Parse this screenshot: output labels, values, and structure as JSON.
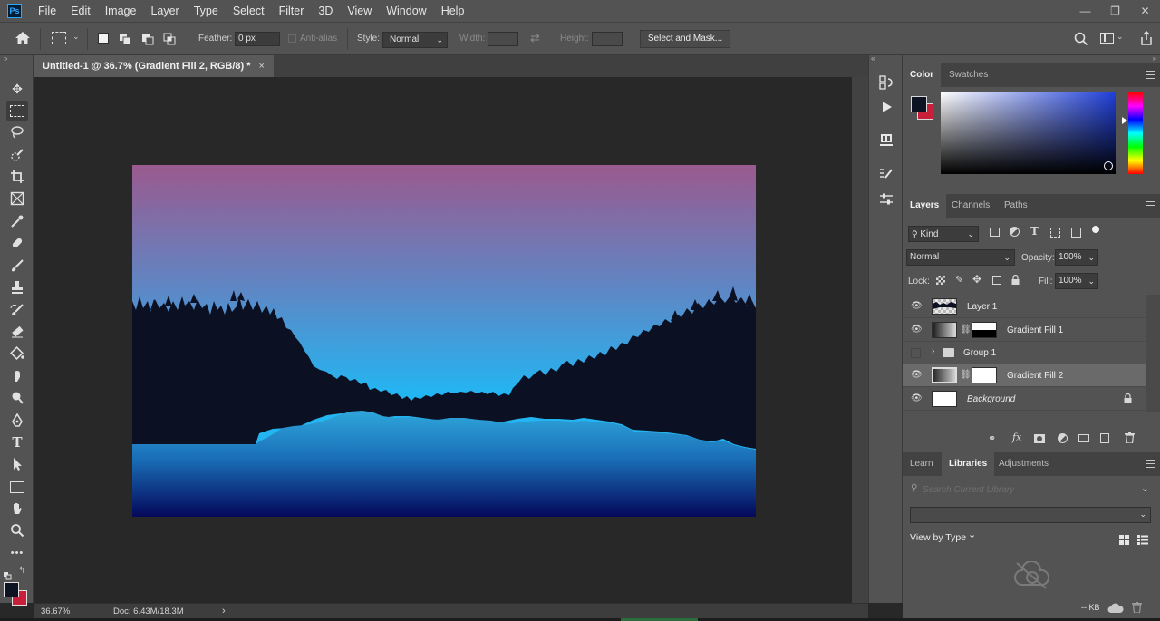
{
  "app": {
    "logo": "Ps"
  },
  "menu": [
    "File",
    "Edit",
    "Image",
    "Layer",
    "Type",
    "Select",
    "Filter",
    "3D",
    "View",
    "Window",
    "Help"
  ],
  "window_controls": {
    "minimize": "—",
    "restore": "❐",
    "close": "✕"
  },
  "options": {
    "feather_label": "Feather:",
    "feather_value": "0 px",
    "antialias_label": "Anti-alias",
    "style_label": "Style:",
    "style_value": "Normal",
    "width_label": "Width:",
    "height_label": "Height:",
    "select_mask_label": "Select and Mask..."
  },
  "document": {
    "tab_title": "Untitled-1 @ 36.7% (Gradient Fill 2, RGB/8) *",
    "tab_close": "×"
  },
  "status": {
    "zoom": "36.67%",
    "doc": "Doc: 6.43M/18.3M",
    "arrow": "›"
  },
  "color_panel": {
    "tabs": [
      "Color",
      "Swatches"
    ],
    "foreground": "#0d1322",
    "background": "#c81f3b"
  },
  "layers_panel": {
    "tabs": [
      "Layers",
      "Channels",
      "Paths"
    ],
    "filter_kind": "Kind",
    "blend_mode": "Normal",
    "opacity_label": "Opacity:",
    "opacity_value": "100%",
    "lock_label": "Lock:",
    "fill_label": "Fill:",
    "fill_value": "100%",
    "layers": [
      {
        "name": "Layer 1",
        "visible": true,
        "selected": false
      },
      {
        "name": "Gradient Fill 1",
        "visible": true,
        "selected": false
      },
      {
        "name": "Group 1",
        "visible": false,
        "selected": false
      },
      {
        "name": "Gradient Fill 2",
        "visible": true,
        "selected": true
      },
      {
        "name": "Background",
        "visible": true,
        "selected": false,
        "locked": true
      }
    ]
  },
  "libraries_panel": {
    "tabs": [
      "Learn",
      "Libraries",
      "Adjustments"
    ],
    "search_placeholder": "Search Current Library",
    "view_by": "View by Type",
    "size_label": "-- KB"
  },
  "colors": {
    "sky_top": "#9a5a8f",
    "sky_mid": "#5f86c4",
    "sky_bottom": "#23b5f2",
    "trees": "#0b1122",
    "water_top": "#2fa6db",
    "water_bottom": "#04085a"
  }
}
